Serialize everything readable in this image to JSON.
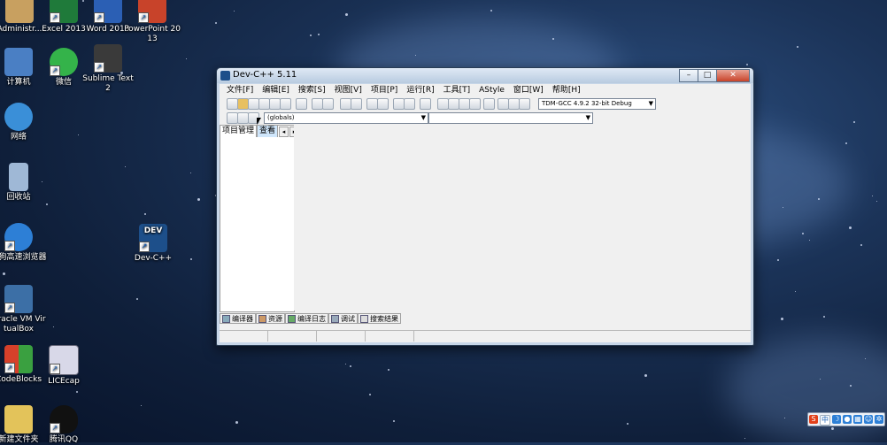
{
  "desktop": {
    "icons": [
      {
        "label": "Administr...",
        "color": "#c8a060"
      },
      {
        "label": "Excel 2013",
        "color": "#1f7a3a"
      },
      {
        "label": "Word 2013",
        "color": "#2b5fb4"
      },
      {
        "label": "PowerPoint 2013",
        "color": "#c8432a"
      },
      {
        "label": "计算机",
        "color": "#4a7fc4"
      },
      {
        "label": "微信",
        "color": "#34b34a"
      },
      {
        "label": "Sublime Text 2",
        "color": "#3a3a3a"
      },
      {
        "label": "网络",
        "color": "#3a8fd8"
      },
      {
        "label": "回收站",
        "color": "#9fb8d6"
      },
      {
        "label": "搜狗高速浏览器",
        "color": "#2d7fd6"
      },
      {
        "label": "Dev-C++",
        "color": "#1d4f8a"
      },
      {
        "label": "Oracle VM VirtualBox",
        "color": "#3c6fa6"
      },
      {
        "label": "CodeBlocks",
        "color": "#d6402a"
      },
      {
        "label": "LICEcap",
        "color": "#d8d8e8"
      },
      {
        "label": "新建文件夹",
        "color": "#e3c35a"
      },
      {
        "label": "腾讯QQ",
        "color": "#111111"
      }
    ]
  },
  "window": {
    "title": "Dev-C++ 5.11",
    "buttons": {
      "minimize": "–",
      "maximize": "□",
      "close": "✕"
    },
    "menu": [
      "文件[F]",
      "编辑[E]",
      "搜索[S]",
      "视图[V]",
      "项目[P]",
      "运行[R]",
      "工具[T]",
      "AStyle",
      "窗口[W]",
      "帮助[H]"
    ],
    "compiler_select": "TDM-GCC 4.9.2 32-bit Debug",
    "scope_select": "(globals)",
    "left_tabs": [
      "项目管理",
      "查看"
    ],
    "bottom_tabs": [
      "编译器",
      "资源",
      "编译日志",
      "调试",
      "搜索结果"
    ]
  },
  "tray": {
    "icons": [
      "sogou-icon",
      "中",
      "moon",
      "mic",
      "keyboard",
      "user",
      "gear"
    ]
  },
  "colors": {
    "titlebar": "#c7d6e8",
    "close": "#c8432a"
  }
}
